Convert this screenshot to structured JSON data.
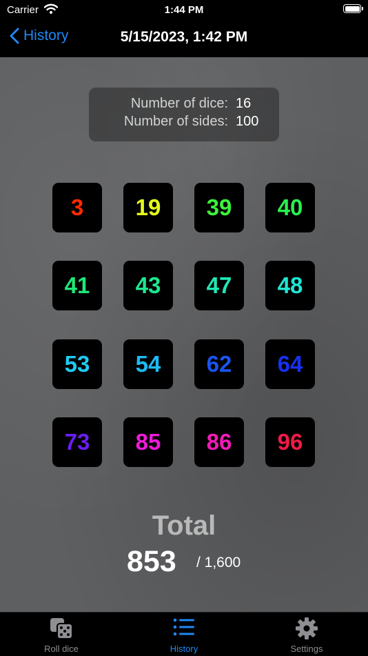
{
  "status_bar": {
    "carrier": "Carrier",
    "time": "1:44 PM"
  },
  "nav": {
    "back_label": "History",
    "title": "5/15/2023, 1:42 PM"
  },
  "info": {
    "dice_label": "Number of dice:",
    "dice_value": "16",
    "sides_label": "Number of sides:",
    "sides_value": "100"
  },
  "dice": [
    {
      "value": "3",
      "color": "#ff2a00"
    },
    {
      "value": "19",
      "color": "#e4ff1a"
    },
    {
      "value": "39",
      "color": "#3cf23c"
    },
    {
      "value": "40",
      "color": "#28f050"
    },
    {
      "value": "41",
      "color": "#1ee878"
    },
    {
      "value": "43",
      "color": "#1ee890"
    },
    {
      "value": "47",
      "color": "#1ee8b4"
    },
    {
      "value": "48",
      "color": "#1ee6d2"
    },
    {
      "value": "53",
      "color": "#1ecaf2"
    },
    {
      "value": "54",
      "color": "#1ebaf2"
    },
    {
      "value": "62",
      "color": "#1a54f0"
    },
    {
      "value": "64",
      "color": "#1830ee"
    },
    {
      "value": "73",
      "color": "#6a1ef0"
    },
    {
      "value": "85",
      "color": "#ee1ad8"
    },
    {
      "value": "86",
      "color": "#f21ab8"
    },
    {
      "value": "96",
      "color": "#f21a46"
    }
  ],
  "total": {
    "label": "Total",
    "value": "853",
    "max": "/ 1,600"
  },
  "tabs": [
    {
      "label": "Roll dice",
      "icon": "dice-icon",
      "active": false
    },
    {
      "label": "History",
      "icon": "list-icon",
      "active": true
    },
    {
      "label": "Settings",
      "icon": "gear-icon",
      "active": false
    }
  ],
  "colors": {
    "accent": "#1e88f5",
    "inactive_tab": "#8e8e93"
  }
}
